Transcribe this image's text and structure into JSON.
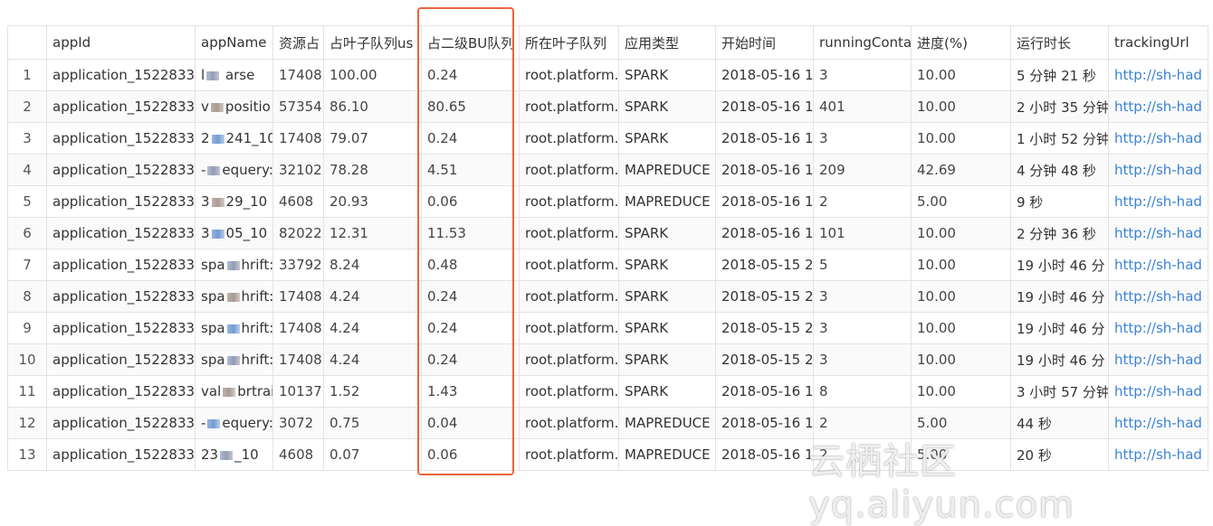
{
  "columns": [
    "",
    "appId",
    "appName",
    "资源占",
    "占叶子队列us",
    "占二级BU队列",
    "所在叶子队列",
    "应用类型",
    "开始时间",
    "runningConta",
    "进度(%)",
    "运行时长",
    "trackingUrl"
  ],
  "rows": [
    {
      "idx": "1",
      "appId": "application_1522833",
      "appName": "l   arse",
      "res": "17408",
      "leaf": "100.00",
      "bu": "0.24",
      "queue": "root.platform.",
      "type": "SPARK",
      "start": "2018-05-16 1",
      "running": "3",
      "progress": "10.00",
      "duration": "5 分钟 21 秒",
      "url": "http://sh-had"
    },
    {
      "idx": "2",
      "appId": "application_1522833",
      "appName": "v  positio",
      "res": "57354",
      "leaf": "86.10",
      "bu": "80.65",
      "queue": "root.platform.",
      "type": "SPARK",
      "start": "2018-05-16 1",
      "running": "401",
      "progress": "10.00",
      "duration": "2 小时 35 分钟",
      "url": "http://sh-had"
    },
    {
      "idx": "3",
      "appId": "application_1522833",
      "appName": "2  241_10",
      "res": "17408",
      "leaf": "79.07",
      "bu": "0.24",
      "queue": "root.platform.",
      "type": "SPARK",
      "start": "2018-05-16 1",
      "running": "3",
      "progress": "10.00",
      "duration": "1 小时 52 分钟",
      "url": "http://sh-had"
    },
    {
      "idx": "4",
      "appId": "application_1522833",
      "appName": "-  equery:",
      "res": "32102",
      "leaf": "78.28",
      "bu": "4.51",
      "queue": "root.platform.",
      "type": "MAPREDUCE",
      "start": "2018-05-16 1",
      "running": "209",
      "progress": "42.69",
      "duration": "4 分钟 48 秒",
      "url": "http://sh-had"
    },
    {
      "idx": "5",
      "appId": "application_1522833",
      "appName": "3  29_10",
      "res": "4608",
      "leaf": "20.93",
      "bu": "0.06",
      "queue": "root.platform.",
      "type": "MAPREDUCE",
      "start": "2018-05-16 1",
      "running": "2",
      "progress": "5.00",
      "duration": "9 秒",
      "url": "http://sh-had"
    },
    {
      "idx": "6",
      "appId": "application_1522833",
      "appName": "3  05_10",
      "res": "82022",
      "leaf": "12.31",
      "bu": "11.53",
      "queue": "root.platform.",
      "type": "SPARK",
      "start": "2018-05-16 1",
      "running": "101",
      "progress": "10.00",
      "duration": "2 分钟 36 秒",
      "url": "http://sh-had"
    },
    {
      "idx": "7",
      "appId": "application_1522833",
      "appName": "spa  hrift:",
      "res": "33792",
      "leaf": "8.24",
      "bu": "0.48",
      "queue": "root.platform.",
      "type": "SPARK",
      "start": "2018-05-15 2",
      "running": "5",
      "progress": "10.00",
      "duration": "19 小时 46 分",
      "url": "http://sh-had"
    },
    {
      "idx": "8",
      "appId": "application_1522833",
      "appName": "spa  hrift:",
      "res": "17408",
      "leaf": "4.24",
      "bu": "0.24",
      "queue": "root.platform.",
      "type": "SPARK",
      "start": "2018-05-15 2",
      "running": "3",
      "progress": "10.00",
      "duration": "19 小时 46 分",
      "url": "http://sh-had"
    },
    {
      "idx": "9",
      "appId": "application_1522833",
      "appName": "spa  hrift:",
      "res": "17408",
      "leaf": "4.24",
      "bu": "0.24",
      "queue": "root.platform.",
      "type": "SPARK",
      "start": "2018-05-15 2",
      "running": "3",
      "progress": "10.00",
      "duration": "19 小时 46 分",
      "url": "http://sh-had"
    },
    {
      "idx": "10",
      "appId": "application_1522833",
      "appName": "spa  hrift:",
      "res": "17408",
      "leaf": "4.24",
      "bu": "0.24",
      "queue": "root.platform.",
      "type": "SPARK",
      "start": "2018-05-15 2",
      "running": "3",
      "progress": "10.00",
      "duration": "19 小时 46 分",
      "url": "http://sh-had"
    },
    {
      "idx": "11",
      "appId": "application_1522833",
      "appName": "val  brtrai",
      "res": "10137",
      "leaf": "1.52",
      "bu": "1.43",
      "queue": "root.platform.",
      "type": "SPARK",
      "start": "2018-05-16 1",
      "running": "8",
      "progress": "10.00",
      "duration": "3 小时 57 分钟",
      "url": "http://sh-had"
    },
    {
      "idx": "12",
      "appId": "application_1522833",
      "appName": "-  equery:",
      "res": "3072",
      "leaf": "0.75",
      "bu": "0.04",
      "queue": "root.platform.",
      "type": "MAPREDUCE",
      "start": "2018-05-16 1",
      "running": "2",
      "progress": "5.00",
      "duration": "44 秒",
      "url": "http://sh-had"
    },
    {
      "idx": "13",
      "appId": "application_1522833",
      "appName": "23  _10",
      "res": "4608",
      "leaf": "0.07",
      "bu": "0.06",
      "queue": "root.platform.",
      "type": "MAPREDUCE",
      "start": "2018-05-16 1",
      "running": "2",
      "progress": "5.00",
      "duration": "20 秒",
      "url": "http://sh-had"
    }
  ],
  "watermark": "云栖社区 yq.aliyun.com",
  "colors": {
    "highlight": "#e8663c",
    "link": "#3a82d6"
  }
}
